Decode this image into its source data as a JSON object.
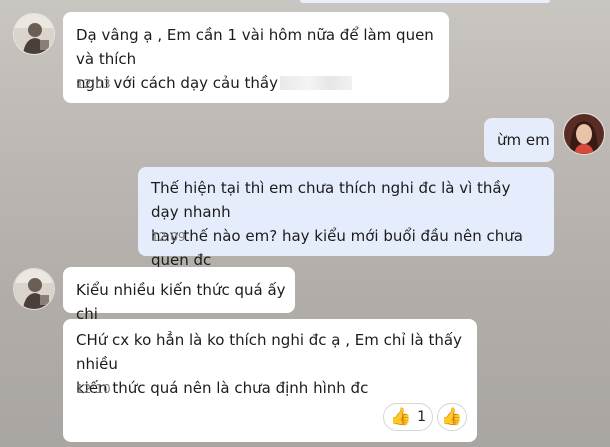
{
  "messages": [
    {
      "sender": "them",
      "text": "Dạ vâng ạ , Em cần 1 vài hôm nữa để làm quen và thích\nnghi với cách dạy cảu thầy",
      "time": "12:03"
    },
    {
      "sender": "me",
      "text": "ừm em"
    },
    {
      "sender": "me",
      "text": "Thế hiện tại thì em chưa thích nghi đc là vì thầy dạy nhanh\nhay thế nào em? hay kiểu mới buổi đầu nên chưa quen đc",
      "time": "12:09"
    },
    {
      "sender": "them",
      "text": "Kiểu nhiều kiến thức quá ấy chị"
    },
    {
      "sender": "them",
      "text": "CHứ cx ko hẳn là ko thích nghi đc ạ , Em chỉ là thấy nhiều\nkiến thức quá nên là chưa định hình đc",
      "time": "12:10",
      "reactions": [
        {
          "emoji": "👍",
          "count": "1"
        },
        {
          "emoji": "👍"
        }
      ]
    }
  ],
  "icons": {
    "thumbs_up": "thumbs-up-icon"
  },
  "colors": {
    "incoming_bubble": "#ffffff",
    "outgoing_bubble": "#e5ecfb",
    "background": "#bcb7b2"
  }
}
